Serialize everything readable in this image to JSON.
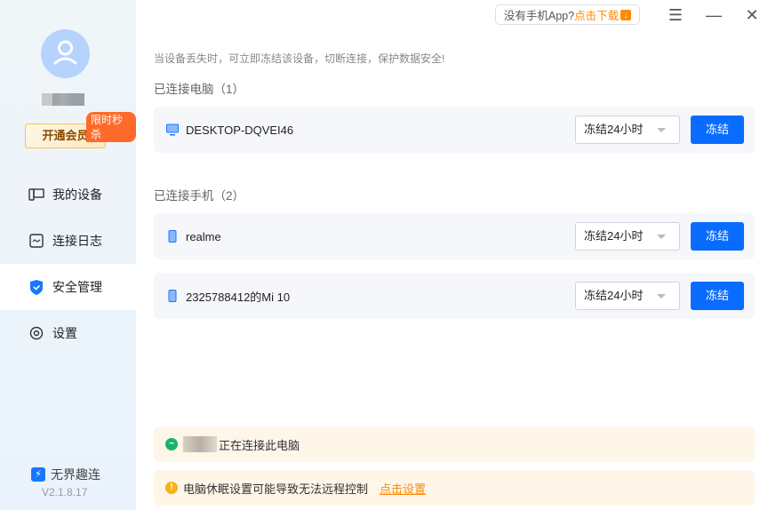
{
  "sidebar": {
    "vip_label": "开通会员",
    "flash_badge": "限时秒杀",
    "items": [
      {
        "label": "我的设备"
      },
      {
        "label": "连接日志"
      },
      {
        "label": "安全管理"
      },
      {
        "label": "设置"
      }
    ],
    "brand": "无界趣连",
    "version": "V2.1.8.17"
  },
  "topbar": {
    "app_prompt": "没有手机App?",
    "download_link": "点击下载"
  },
  "main": {
    "notice": "当设备丢失时，可立即冻结该设备，切断连接，保护数据安全!",
    "pc_section": "已连接电脑（1）",
    "phone_section": "已连接手机（2）",
    "devices": [
      {
        "name": "DESKTOP-DQVEI46",
        "type": "computer",
        "duration": "冻结24小时",
        "action": "冻结"
      },
      {
        "name": "realme",
        "type": "phone",
        "duration": "冻结24小时",
        "action": "冻结"
      },
      {
        "name": "2325788412的Mi 10",
        "type": "phone",
        "duration": "冻结24小时",
        "action": "冻结"
      }
    ],
    "status_text": "正在连接此电脑",
    "warning_text": "电脑休眠设置可能导致无法远程控制",
    "warning_link": "点击设置"
  },
  "colors": {
    "accent": "#0a6cff",
    "orange": "#ff8a00",
    "success": "#19b46b",
    "warning": "#f7b219"
  }
}
